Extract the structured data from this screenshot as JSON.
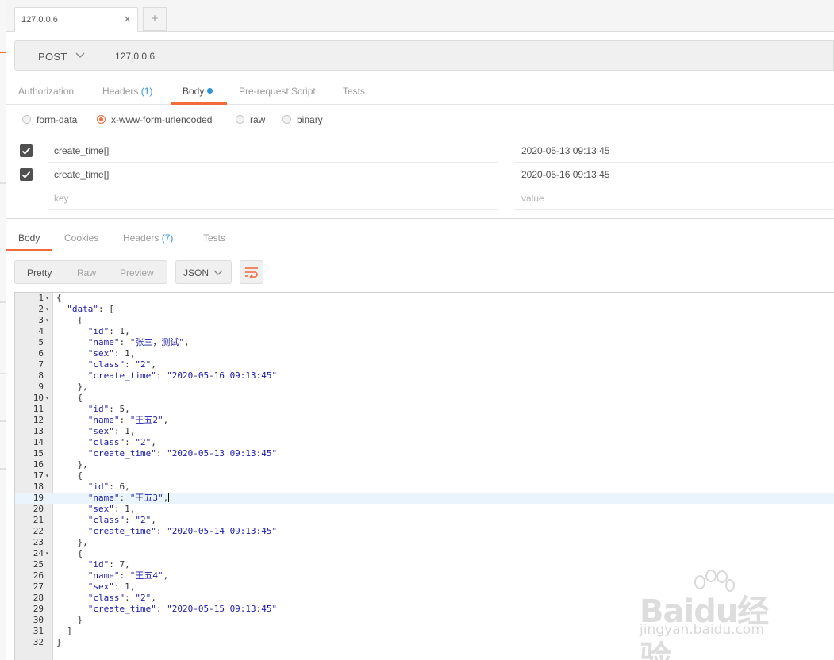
{
  "tab": {
    "label": "127.0.0.6",
    "close_glyph": "×",
    "add_glyph": "+"
  },
  "request": {
    "method": "POST",
    "url": "127.0.0.6"
  },
  "request_tabs": [
    {
      "label": "Authorization"
    },
    {
      "label": "Headers",
      "count": "(1)"
    },
    {
      "label": "Body",
      "active": true
    },
    {
      "label": "Pre-request Script"
    },
    {
      "label": "Tests"
    }
  ],
  "body_types": [
    {
      "label": "form-data"
    },
    {
      "label": "x-www-form-urlencoded",
      "selected": true
    },
    {
      "label": "raw"
    },
    {
      "label": "binary"
    }
  ],
  "params": [
    {
      "checked": true,
      "key": "create_time[]",
      "value": "2020-05-13 09:13:45"
    },
    {
      "checked": true,
      "key": "create_time[]",
      "value": "2020-05-16 09:13:45"
    }
  ],
  "param_placeholder": {
    "key": "key",
    "value": "value"
  },
  "response_tabs": [
    {
      "label": "Body",
      "active": true
    },
    {
      "label": "Cookies"
    },
    {
      "label": "Headers",
      "count": "(7)"
    },
    {
      "label": "Tests"
    }
  ],
  "view_modes": [
    {
      "label": "Pretty",
      "active": true
    },
    {
      "label": "Raw"
    },
    {
      "label": "Preview"
    }
  ],
  "format": "JSON",
  "code": [
    {
      "n": "1",
      "fold": true,
      "t": "{"
    },
    {
      "n": "2",
      "fold": true,
      "t": "  \"data\": ["
    },
    {
      "n": "3",
      "fold": true,
      "t": "    {"
    },
    {
      "n": "4",
      "t": "      \"id\": 1,"
    },
    {
      "n": "5",
      "t": "      \"name\": \"张三，测试\","
    },
    {
      "n": "6",
      "t": "      \"sex\": 1,"
    },
    {
      "n": "7",
      "t": "      \"class\": \"2\","
    },
    {
      "n": "8",
      "t": "      \"create_time\": \"2020-05-16 09:13:45\""
    },
    {
      "n": "9",
      "t": "    },"
    },
    {
      "n": "10",
      "fold": true,
      "t": "    {"
    },
    {
      "n": "11",
      "t": "      \"id\": 5,"
    },
    {
      "n": "12",
      "t": "      \"name\": \"王五2\","
    },
    {
      "n": "13",
      "t": "      \"sex\": 1,"
    },
    {
      "n": "14",
      "t": "      \"class\": \"2\","
    },
    {
      "n": "15",
      "t": "      \"create_time\": \"2020-05-13 09:13:45\""
    },
    {
      "n": "16",
      "t": "    },"
    },
    {
      "n": "17",
      "fold": true,
      "t": "    {"
    },
    {
      "n": "18",
      "t": "      \"id\": 6,"
    },
    {
      "n": "19",
      "t": "      \"name\": \"王五3\",",
      "highlight": true
    },
    {
      "n": "20",
      "t": "      \"sex\": 1,"
    },
    {
      "n": "21",
      "t": "      \"class\": \"2\","
    },
    {
      "n": "22",
      "t": "      \"create_time\": \"2020-05-14 09:13:45\""
    },
    {
      "n": "23",
      "t": "    },"
    },
    {
      "n": "24",
      "fold": true,
      "t": "    {"
    },
    {
      "n": "25",
      "t": "      \"id\": 7,"
    },
    {
      "n": "26",
      "t": "      \"name\": \"王五4\","
    },
    {
      "n": "27",
      "t": "      \"sex\": 1,"
    },
    {
      "n": "28",
      "t": "      \"class\": \"2\","
    },
    {
      "n": "29",
      "t": "      \"create_time\": \"2020-05-15 09:13:45\""
    },
    {
      "n": "30",
      "t": "    }"
    },
    {
      "n": "31",
      "t": "  ]"
    },
    {
      "n": "32",
      "t": "}"
    }
  ],
  "watermark": {
    "logo": "Baidu经验",
    "sub": "jingyan.baidu.com"
  },
  "colors": {
    "accent": "#f26b3a",
    "link": "#2b94d6",
    "json_value": "#1a1aa6"
  },
  "icons": {
    "close": "close-icon",
    "add": "plus-icon",
    "chevron": "chevron-down-icon",
    "wrap": "text-wrap-icon",
    "checkbox": "checkbox-checked-icon"
  }
}
